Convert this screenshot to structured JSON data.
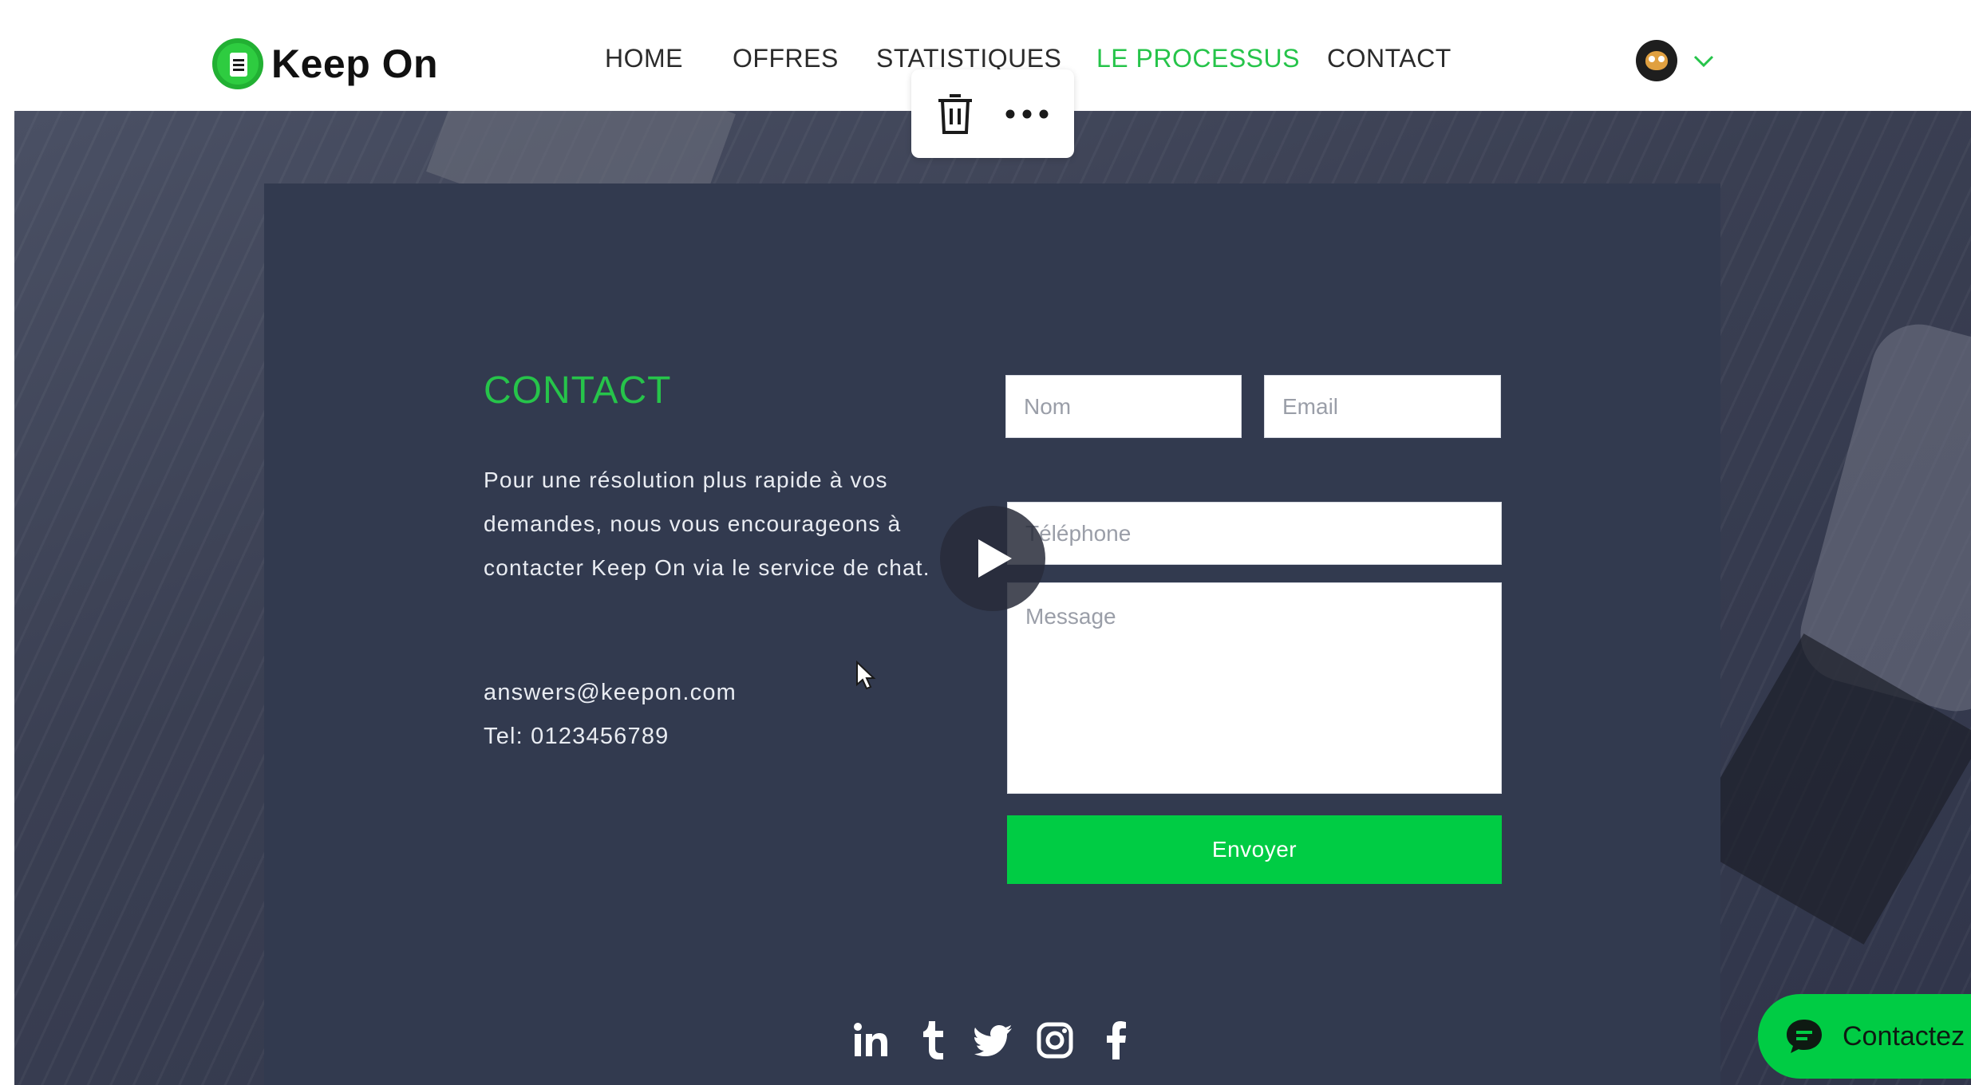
{
  "brand": {
    "name": "Keep On",
    "accent": "#26c44a"
  },
  "nav": {
    "items": [
      {
        "label": "HOME",
        "active": false
      },
      {
        "label": "OFFRES",
        "active": false
      },
      {
        "label": "STATISTIQUES",
        "active": false
      },
      {
        "label": "LE PROCESSUS",
        "active": true
      },
      {
        "label": "CONTACT",
        "active": false
      }
    ]
  },
  "user": {
    "avatar_icon": "owl-avatar-icon",
    "menu_icon": "chevron-down-icon"
  },
  "toolbar": {
    "delete_icon": "trash-icon",
    "more_icon": "more-horizontal-icon"
  },
  "contact": {
    "title": "CONTACT",
    "description": "Pour une résolution plus rapide à vos demandes, nous vous encourageons à contacter Keep On via le service de chat.",
    "email": "answers@keepon.com",
    "tel": "Tel: 0123456789"
  },
  "form": {
    "nom_placeholder": "Nom",
    "email_placeholder": "Email",
    "telephone_placeholder": "Téléphone",
    "message_placeholder": "Message",
    "submit_label": "Envoyer",
    "submit_color": "#00cc44"
  },
  "social": [
    "linkedin-icon",
    "tumblr-icon",
    "twitter-icon",
    "instagram-icon",
    "facebook-icon"
  ],
  "chat": {
    "label": "Contactez",
    "icon": "chat-bubble-icon"
  }
}
